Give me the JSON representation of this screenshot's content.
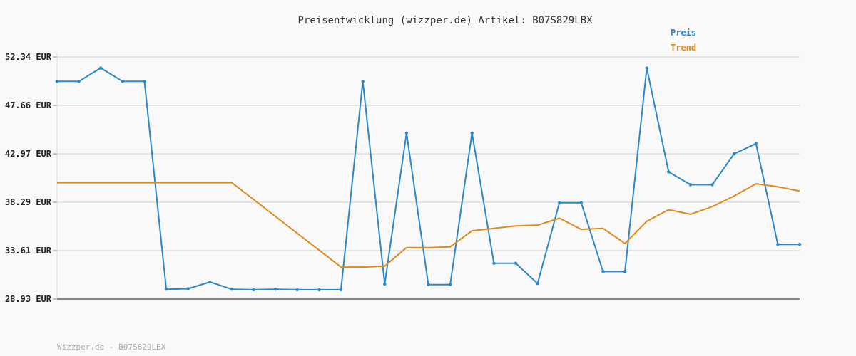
{
  "chart_data": {
    "type": "line",
    "title": "Preisentwicklung (wizzper.de) Artikel: B07S829LBX",
    "xlabel": "",
    "ylabel": "",
    "ylim": [
      28.93,
      52.34
    ],
    "y_ticks": [
      "52.34 EUR",
      "47.66 EUR",
      "42.97 EUR",
      "38.29 EUR",
      "33.61 EUR",
      "28.93 EUR"
    ],
    "y_tick_values": [
      52.34,
      47.66,
      42.97,
      38.29,
      33.61,
      28.93
    ],
    "grid": true,
    "legend_placement": "top-right",
    "x": [
      0,
      1,
      2,
      3,
      4,
      5,
      6,
      7,
      8,
      9,
      10,
      11,
      12,
      13,
      14,
      15,
      16,
      17,
      18,
      19,
      20,
      21,
      22,
      23,
      24,
      25,
      26,
      27,
      28,
      29,
      30,
      31,
      32,
      33,
      34
    ],
    "series": [
      {
        "name": "Preis",
        "color": "#2a88c8",
        "markers": true,
        "values": [
          49.98,
          49.98,
          51.27,
          49.98,
          49.98,
          29.88,
          29.93,
          30.58,
          29.88,
          29.83,
          29.88,
          29.83,
          29.83,
          29.83,
          49.98,
          30.38,
          44.98,
          30.33,
          30.33,
          44.98,
          32.39,
          32.39,
          30.43,
          38.24,
          38.24,
          31.59,
          31.59,
          51.27,
          41.23,
          39.99,
          39.99,
          42.97,
          43.96,
          34.22,
          34.22
        ]
      },
      {
        "name": "Trend",
        "color": "#e08a1e",
        "markers": false,
        "values": [
          40.18,
          40.18,
          40.18,
          40.18,
          40.18,
          40.18,
          40.18,
          40.18,
          40.18,
          null,
          null,
          null,
          null,
          32.02,
          32.02,
          32.12,
          33.91,
          33.91,
          33.98,
          35.53,
          35.77,
          36.01,
          36.07,
          36.75,
          35.67,
          35.77,
          34.31,
          36.45,
          37.57,
          37.13,
          37.87,
          38.89,
          40.08,
          39.79,
          39.37
        ]
      }
    ]
  },
  "footer_text": "Wizzper.de - B07S829LBX"
}
